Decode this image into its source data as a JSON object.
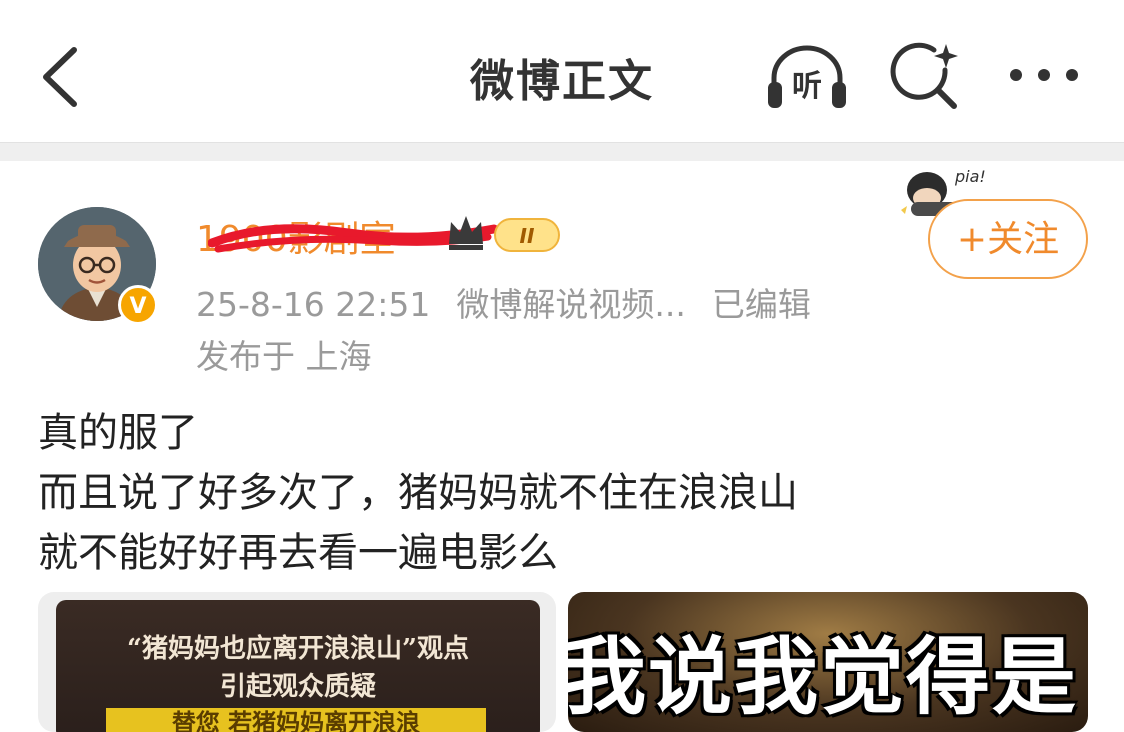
{
  "header": {
    "title": "微博正文",
    "listen_label": "听"
  },
  "post": {
    "username": "1900影剧室",
    "level_badge": "II",
    "timestamp": "25-8-16 22:51",
    "source": "微博解说视频...",
    "edited": "已编辑",
    "location": "发布于 上海",
    "follow_label": "+关注",
    "pia_text": "pia!",
    "verified_mark": "V",
    "text_lines": [
      "真的服了",
      "而且说了好多次了，猪妈妈就不住在浪浪山",
      "就不能好好再去看一遍电影么"
    ]
  },
  "media": [
    {
      "line1": "“猪妈妈也应离开浪浪山”观点",
      "line2": "引起观众质疑",
      "line3": "替您 若猪妈妈离开浪浪"
    },
    {
      "caption": "我说我觉得是"
    }
  ],
  "colors": {
    "accent": "#f08a2c",
    "meta_gray": "#9a9a9a"
  }
}
